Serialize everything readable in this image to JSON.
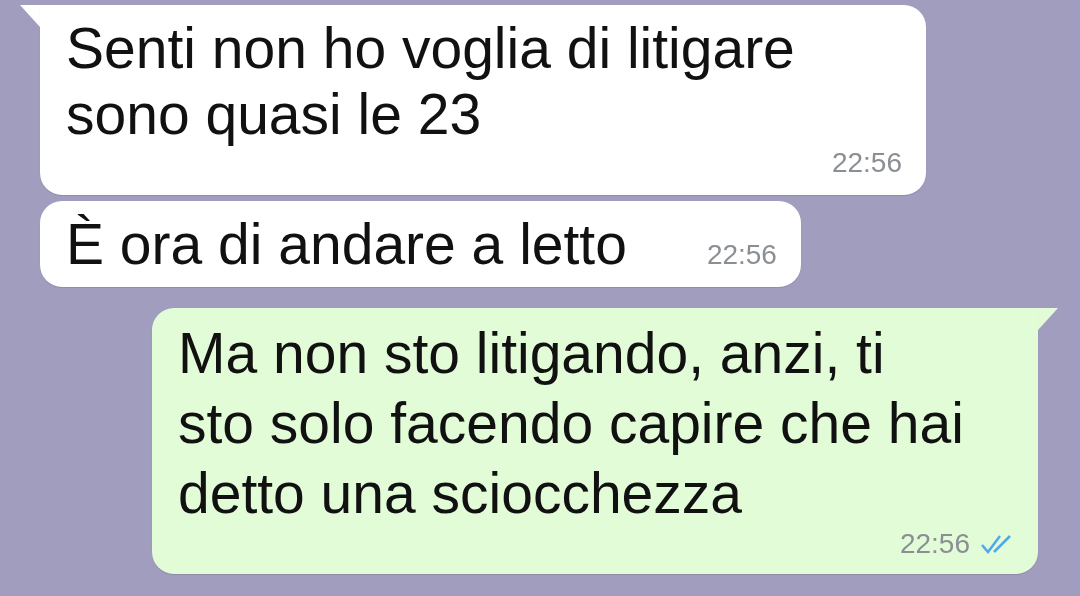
{
  "messages": [
    {
      "outgoing": false,
      "text": "Senti non ho voglia di litigare\nsono quasi le 23",
      "time": "22:56",
      "tail": true
    },
    {
      "outgoing": false,
      "text": "È ora di andare a letto",
      "time": "22:56",
      "tail": false
    },
    {
      "outgoing": true,
      "text": "Ma non sto litigando, anzi, ti\nsto solo facendo capire che hai\ndetto una sciocchezza",
      "time": "22:56",
      "tail": true,
      "read": true
    }
  ]
}
